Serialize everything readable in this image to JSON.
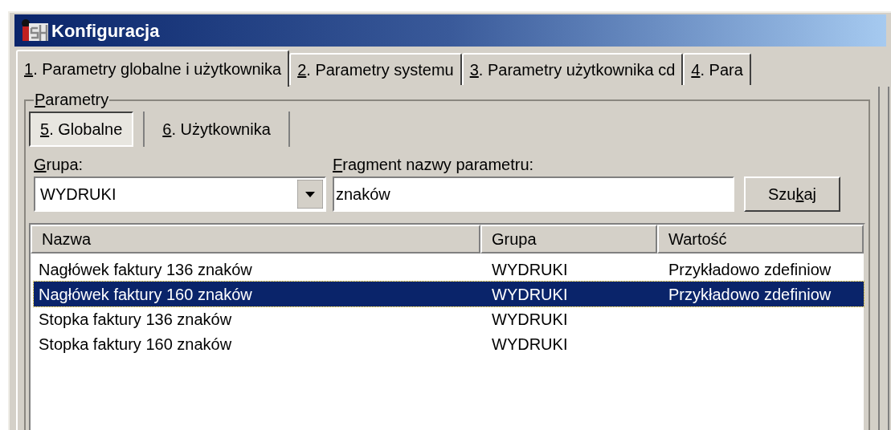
{
  "window": {
    "title": "Konfiguracja"
  },
  "tabs": [
    {
      "key": "1",
      "post": ". Parametry globalne i użytkownika",
      "selected": true
    },
    {
      "key": "2",
      "post": ". Parametry systemu",
      "selected": false
    },
    {
      "key": "3",
      "post": ". Parametry użytkownika cd",
      "selected": false
    },
    {
      "key": "4",
      "post": ". Para",
      "selected": false
    }
  ],
  "group": {
    "title": {
      "key": "P",
      "post": "arametry"
    }
  },
  "subtabs": [
    {
      "key": "5",
      "post": ". Globalne",
      "selected": true
    },
    {
      "key": "6",
      "post": ". Użytkownika",
      "selected": false
    }
  ],
  "filters": {
    "group_label": {
      "key": "G",
      "post": "rupa:"
    },
    "group_value": "WYDRUKI",
    "name_label": {
      "key": "F",
      "post": "ragment nazwy parametru:"
    },
    "name_value": "znaków",
    "search_button": {
      "pre": "Szu",
      "key": "k",
      "post": "aj"
    }
  },
  "table": {
    "columns": [
      "Nazwa",
      "Grupa",
      "Wartość"
    ],
    "rows": [
      {
        "cells": [
          "Nagłówek faktury 136 znaków",
          "WYDRUKI",
          "Przykładowo zdefiniow"
        ],
        "selected": false
      },
      {
        "cells": [
          "Nagłówek faktury 160 znaków",
          "WYDRUKI",
          "Przykładowo zdefiniow"
        ],
        "selected": true
      },
      {
        "cells": [
          "Stopka faktury 136 znaków",
          "WYDRUKI",
          ""
        ],
        "selected": false
      },
      {
        "cells": [
          "Stopka faktury 160 znaków",
          "WYDRUKI",
          ""
        ],
        "selected": false
      }
    ]
  }
}
